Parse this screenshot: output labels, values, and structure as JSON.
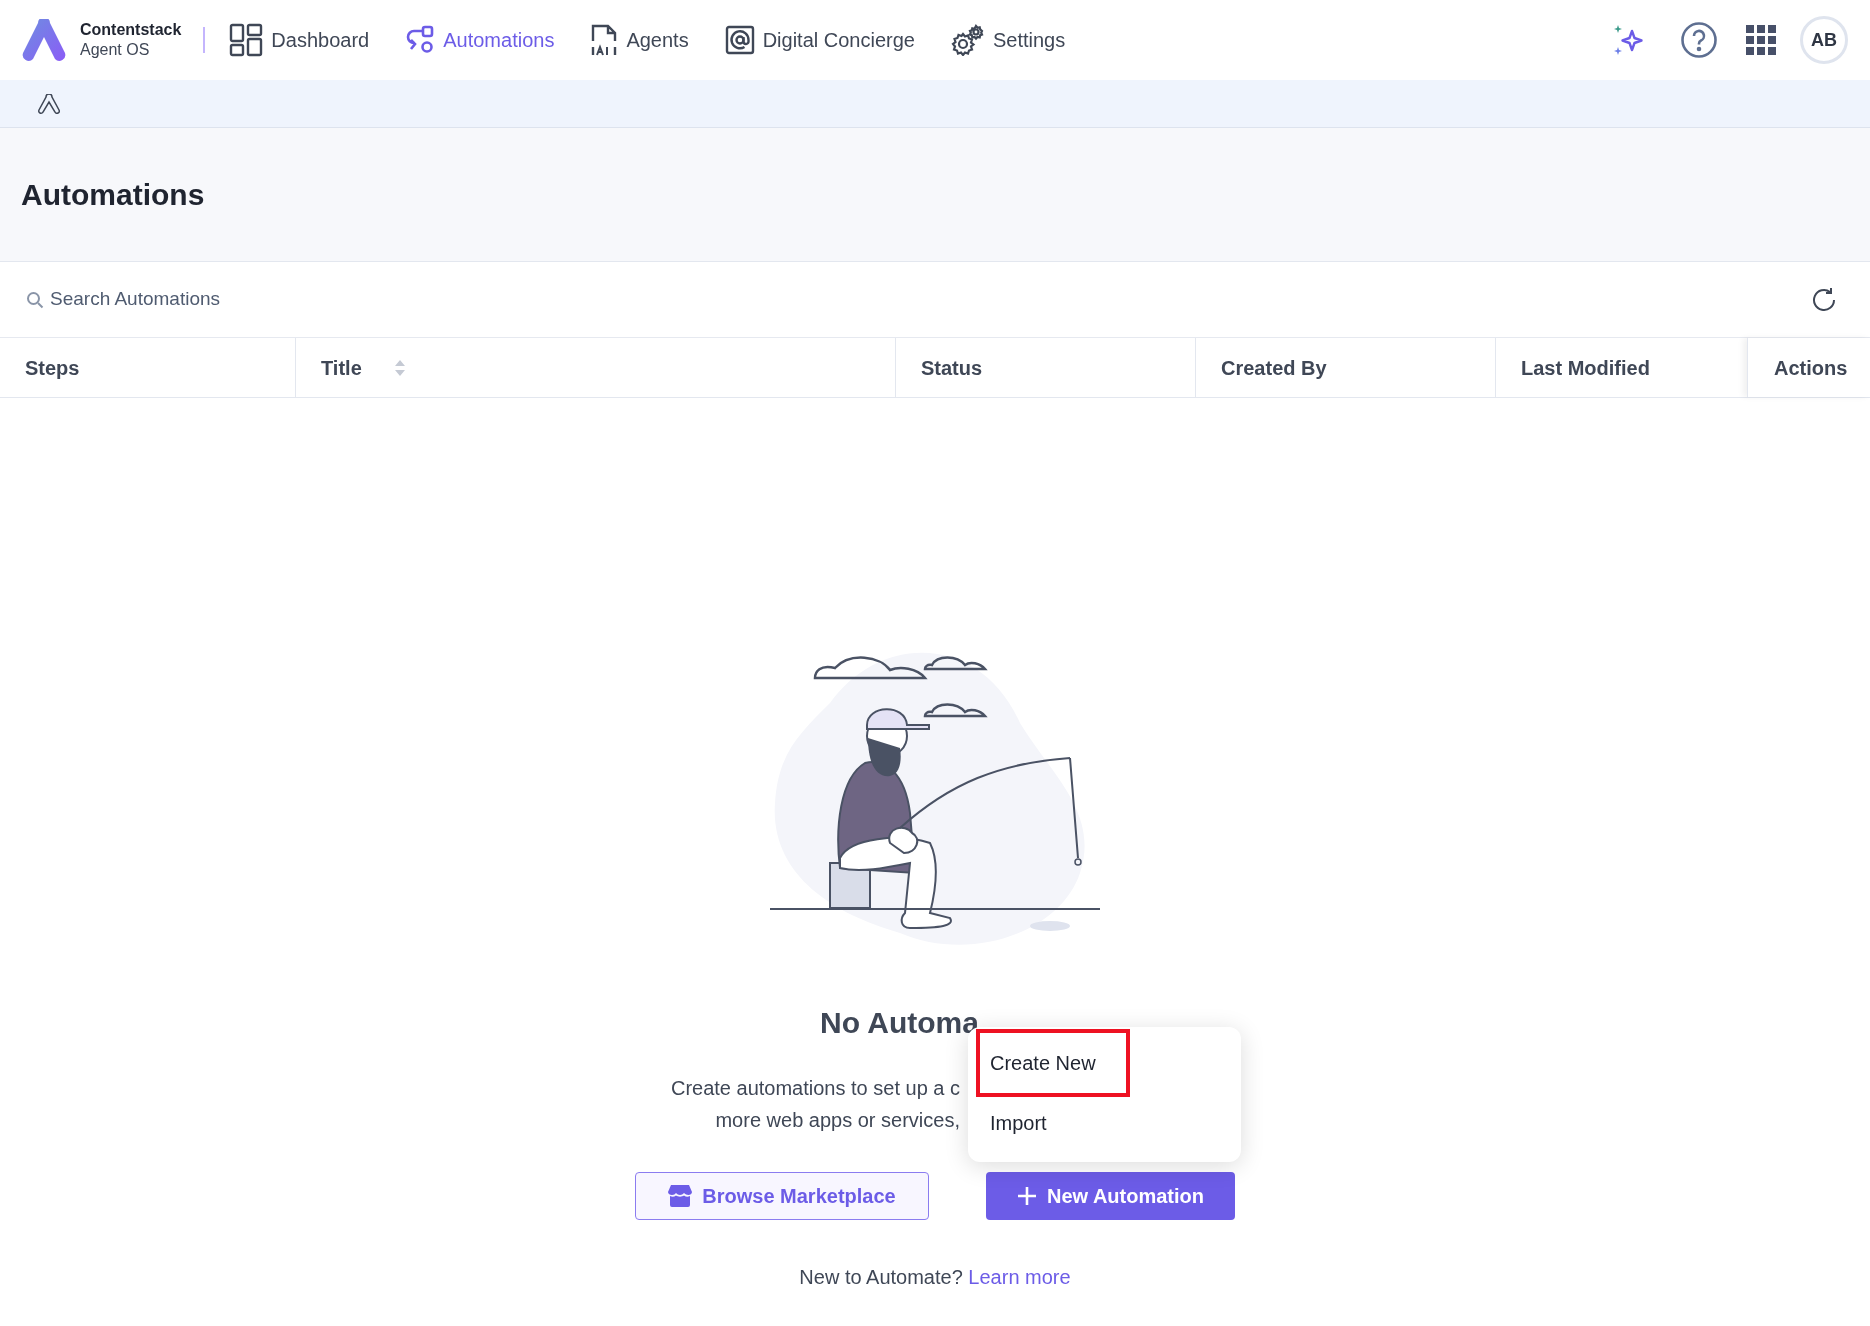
{
  "nav": {
    "brand": {
      "name": "Contentstack",
      "product": "Agent OS"
    },
    "items": [
      {
        "label": "Dashboard",
        "kind": "dashboard",
        "selected": false
      },
      {
        "label": "Automations",
        "kind": "automations",
        "selected": true
      },
      {
        "label": "Agents",
        "kind": "agents",
        "selected": false
      },
      {
        "label": "Digital Concierge",
        "kind": "concierge",
        "selected": false
      },
      {
        "label": "Settings",
        "kind": "settings",
        "selected": false
      }
    ],
    "avatar": "AB"
  },
  "page": {
    "title": "Automations"
  },
  "search": {
    "placeholder": "Search Automations"
  },
  "table": {
    "columns": [
      {
        "label": "Steps",
        "sortable": false
      },
      {
        "label": "Title",
        "sortable": true
      },
      {
        "label": "Status",
        "sortable": false
      },
      {
        "label": "Created By",
        "sortable": false
      },
      {
        "label": "Last Modified",
        "sortable": false
      },
      {
        "label": "Actions",
        "sortable": false
      }
    ]
  },
  "empty_state": {
    "heading": "No Automa",
    "lines": [
      "Create automations to set up a c",
      "more web apps or services,"
    ],
    "buttons": [
      {
        "kind": "secondary",
        "label": "Browse Marketplace"
      },
      {
        "kind": "primary",
        "label": "New Automation"
      }
    ],
    "footer": {
      "text": "New to Automate?",
      "link": "Learn more"
    }
  },
  "menu": {
    "items": [
      {
        "label": "Create New",
        "highlighted": true
      },
      {
        "label": "Import",
        "highlighted": false
      }
    ]
  }
}
